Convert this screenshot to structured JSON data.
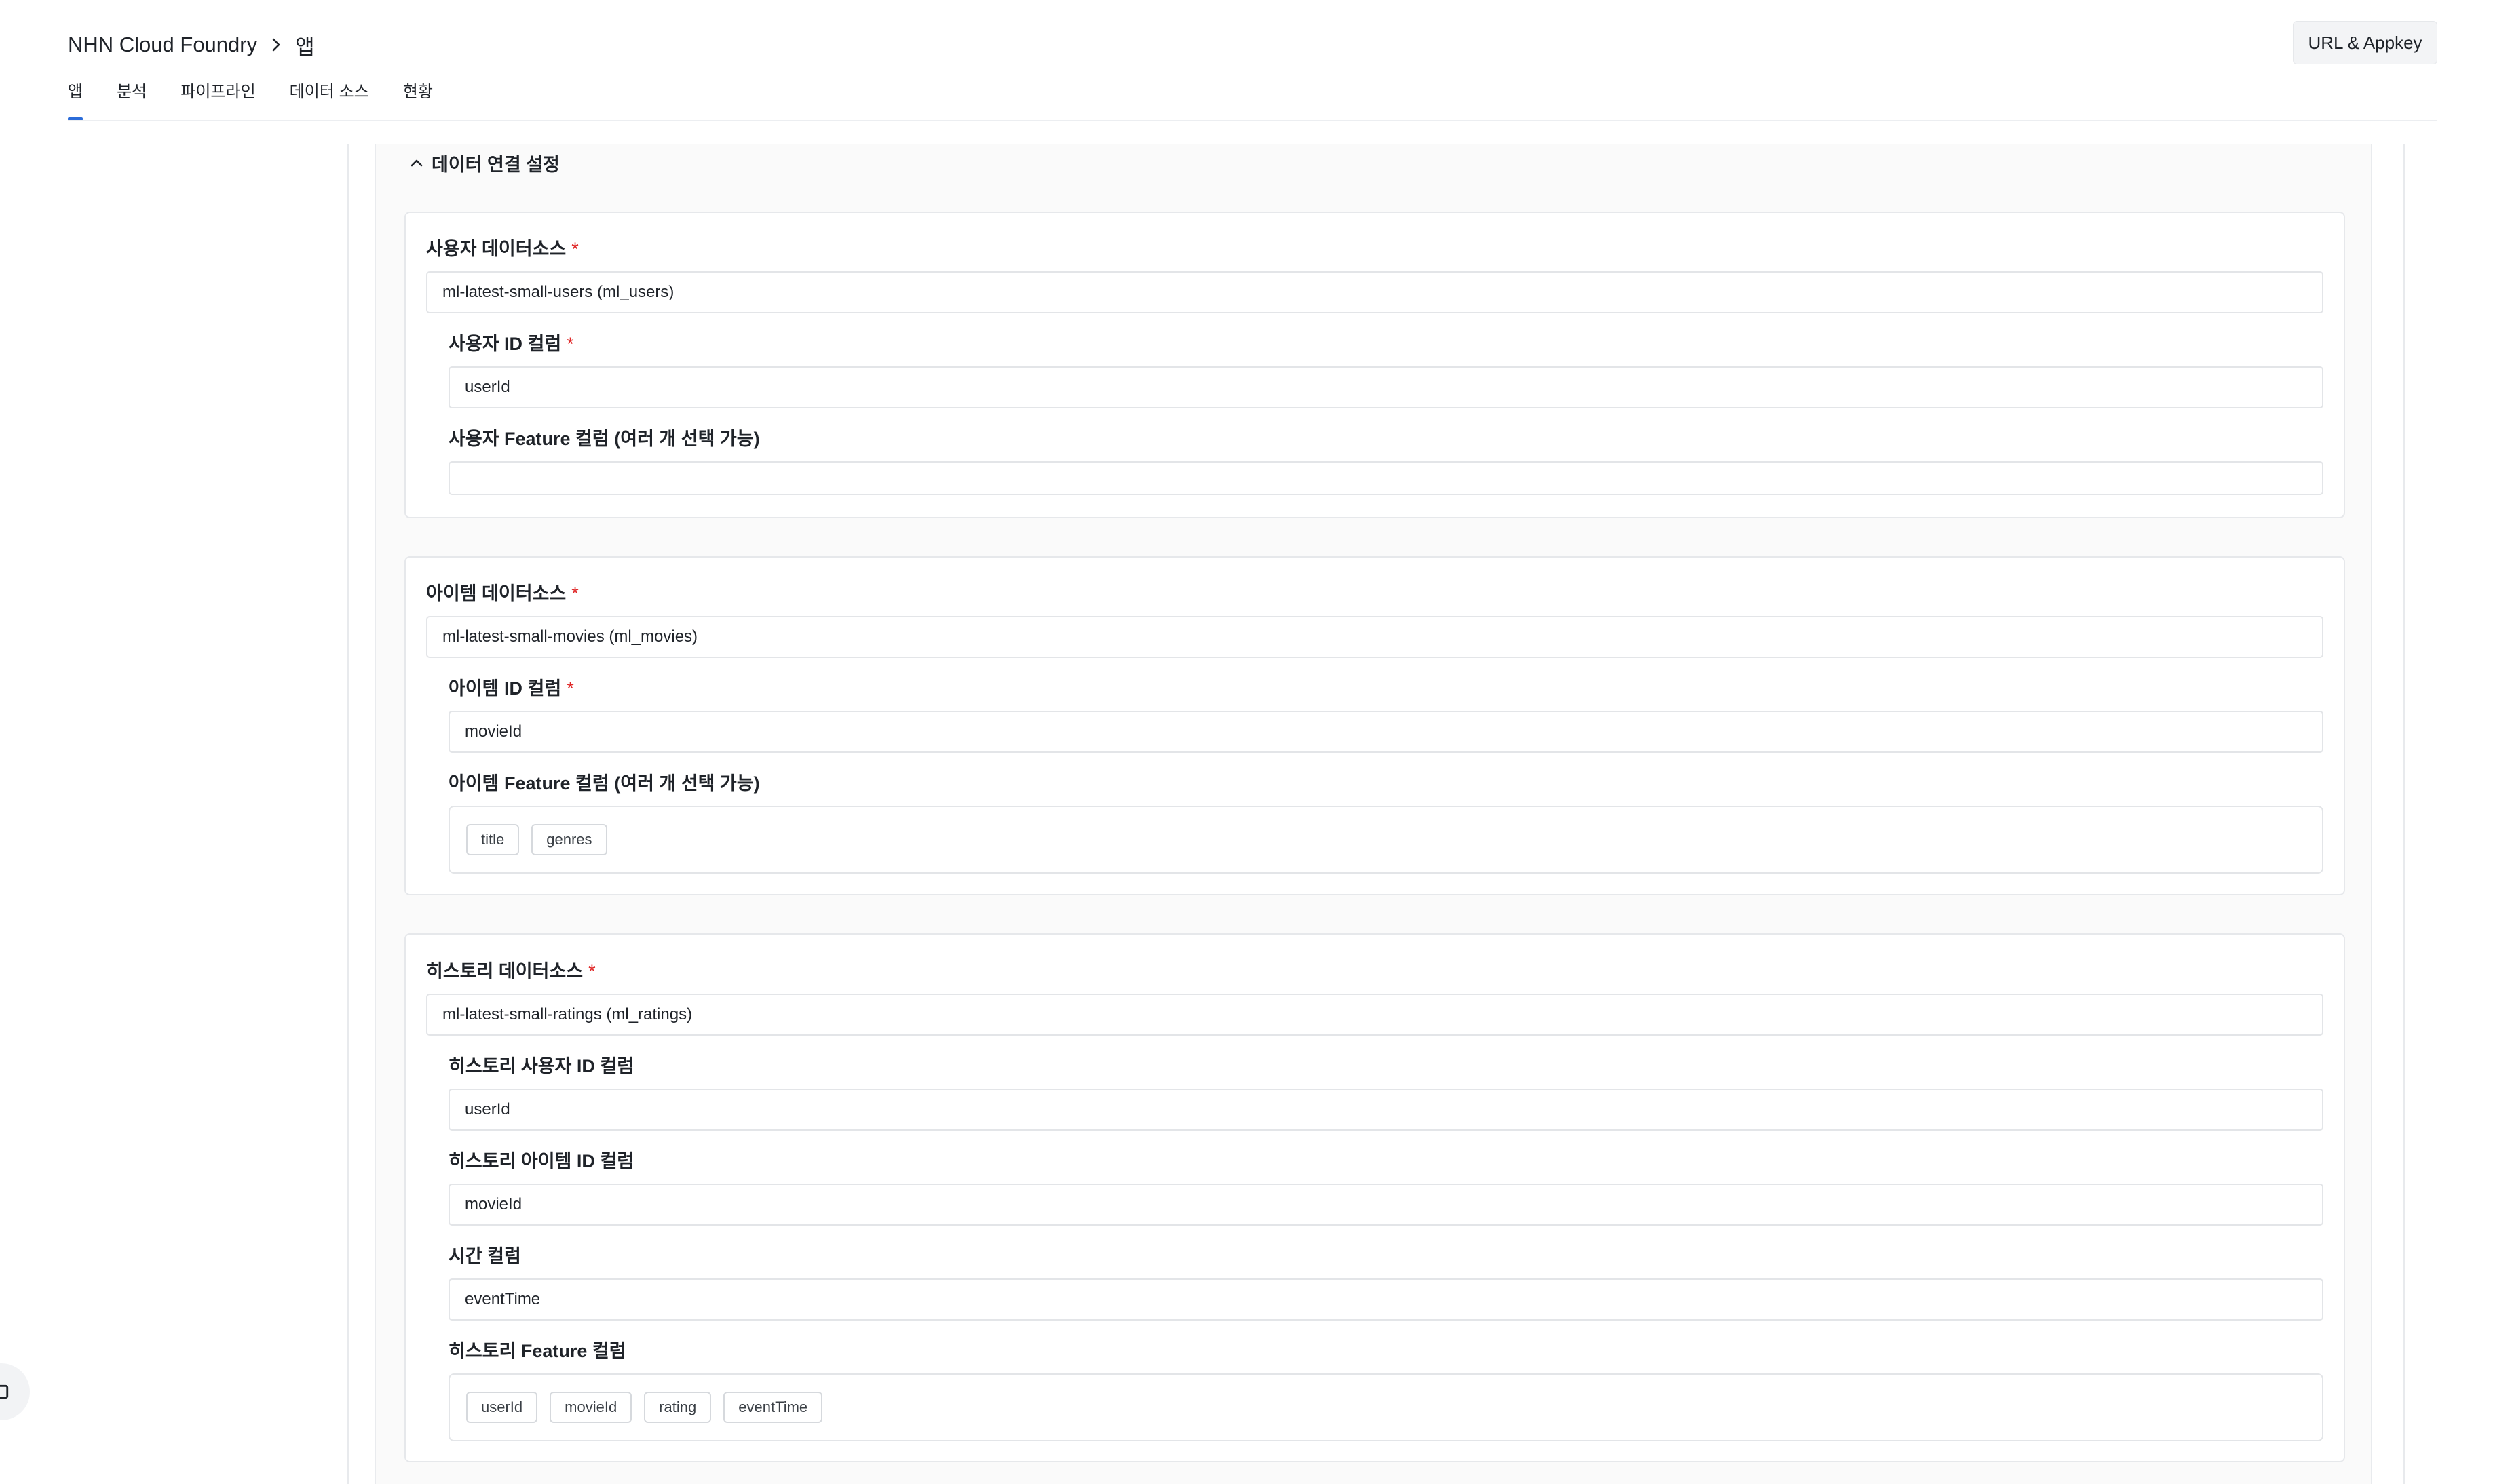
{
  "header": {
    "breadcrumb_root": "NHN Cloud Foundry",
    "breadcrumb_current": "앱",
    "url_appkey_button": "URL & Appkey"
  },
  "tabs": [
    {
      "label": "앱",
      "active": true
    },
    {
      "label": "분석",
      "active": false
    },
    {
      "label": "파이프라인",
      "active": false
    },
    {
      "label": "데이터 소스",
      "active": false
    },
    {
      "label": "현황",
      "active": false
    }
  ],
  "section": {
    "title": "데이터 연결 설정",
    "icon": "chevron-up-icon"
  },
  "required_mark": "*",
  "user_card": {
    "datasource_label": "사용자 데이터소스",
    "datasource_value": "ml-latest-small-users (ml_users)",
    "id_label": "사용자 ID 컬럼",
    "id_value": "userId",
    "feature_label": "사용자 Feature 컬럼 (여러 개 선택 가능)",
    "feature_value": ""
  },
  "item_card": {
    "datasource_label": "아이템 데이터소스",
    "datasource_value": "ml-latest-small-movies (ml_movies)",
    "id_label": "아이템 ID 컬럼",
    "id_value": "movieId",
    "feature_label": "아이템 Feature 컬럼 (여러 개 선택 가능)",
    "feature_chips": [
      "title",
      "genres"
    ]
  },
  "history_card": {
    "datasource_label": "히스토리 데이터소스",
    "datasource_value": "ml-latest-small-ratings (ml_ratings)",
    "user_id_label": "히스토리 사용자 ID 컬럼",
    "user_id_value": "userId",
    "item_id_label": "히스토리 아이템 ID 컬럼",
    "item_id_value": "movieId",
    "time_label": "시간 컬럼",
    "time_value": "eventTime",
    "feature_label": "히스토리 Feature 컬럼",
    "feature_chips": [
      "userId",
      "movieId",
      "rating",
      "eventTime"
    ]
  },
  "colors": {
    "accent": "#2b6cd9",
    "required": "#e02828",
    "border": "#e3e5e8"
  }
}
